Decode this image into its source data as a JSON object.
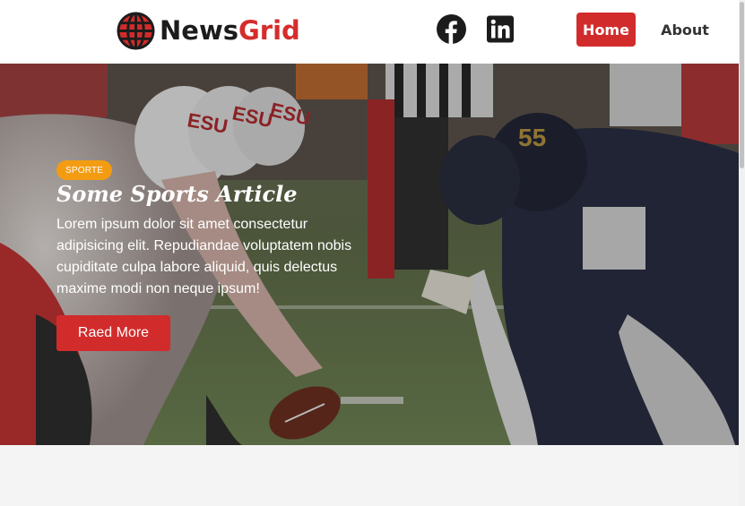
{
  "header": {
    "brand_part1": "News",
    "brand_part2": "Grid",
    "social": [
      "facebook-icon",
      "linkedin-icon"
    ],
    "nav": {
      "home": "Home",
      "about": "About"
    }
  },
  "hero": {
    "category": "SPORTE",
    "title": "Some Sports Article",
    "excerpt": "Lorem ipsum dolor sit amet consectetur adipisicing elit. Repudiandae voluptatem nobis cupiditate culpa labore aliquid, quis delectus maxime modi non neque ipsum!",
    "button": "Raed More",
    "jersey_number": "55",
    "helmet_letters": "ESU"
  },
  "colors": {
    "accent": "#d22b2b",
    "badge": "#f39c12",
    "text_dark": "#1c1c1c"
  }
}
